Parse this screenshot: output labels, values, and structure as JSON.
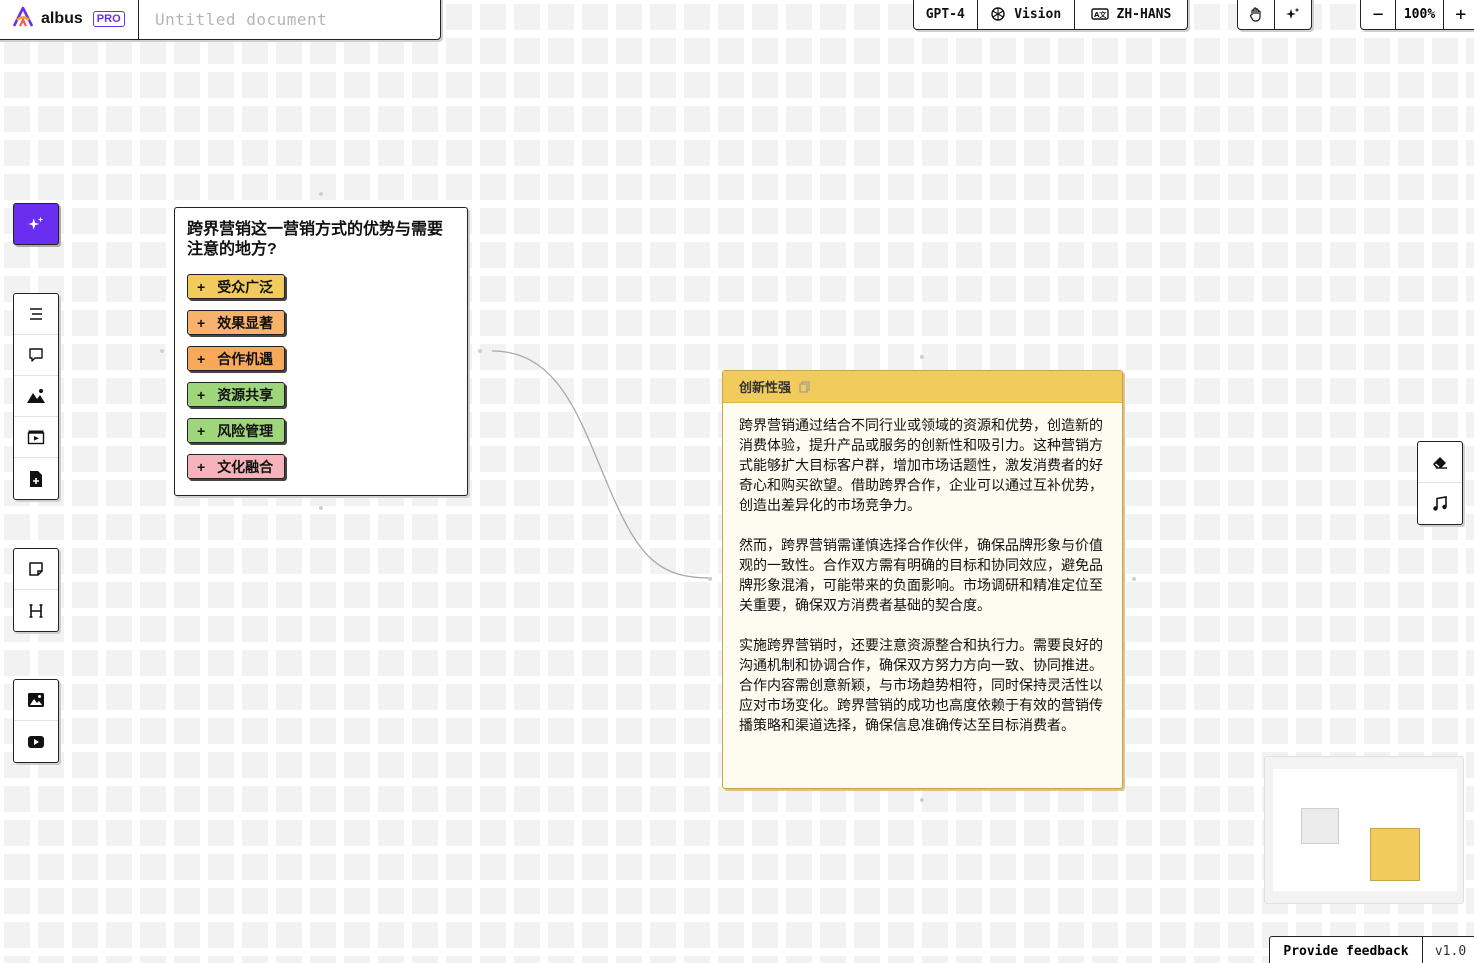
{
  "app": {
    "name": "albus",
    "badge": "PRO",
    "document_title_placeholder": "Untitled document"
  },
  "header": {
    "model": "GPT-4",
    "vision": "Vision",
    "language": "ZH-HANS",
    "zoom_level": "100%",
    "zoom_out": "−",
    "zoom_in": "+"
  },
  "question_card": {
    "question": "跨界营销这一营销方式的优势与需要注意的地方?",
    "chips": [
      {
        "label": "受众广泛",
        "color": "#f1cc5c"
      },
      {
        "label": "效果显著",
        "color": "#f8b26c"
      },
      {
        "label": "合作机遇",
        "color": "#f8a85a"
      },
      {
        "label": "资源共享",
        "color": "#9fd67c"
      },
      {
        "label": "风险管理",
        "color": "#9fd67c"
      },
      {
        "label": "文化融合",
        "color": "#f7b3bb"
      }
    ],
    "plus": "+"
  },
  "note_card": {
    "title": "创新性强",
    "paragraphs": [
      "跨界营销通过结合不同行业或领域的资源和优势，创造新的消费体验，提升产品或服务的创新性和吸引力。这种营销方式能够扩大目标客户群，增加市场话题性，激发消费者的好奇心和购买欲望。借助跨界合作，企业可以通过互补优势，创造出差异化的市场竞争力。",
      "然而，跨界营销需谨慎选择合作伙伴，确保品牌形象与价值观的一致性。合作双方需有明确的目标和协同效应，避免品牌形象混淆，可能带来的负面影响。市场调研和精准定位至关重要，确保双方消费者基础的契合度。",
      "实施跨界营销时，还要注意资源整合和执行力。需要良好的沟通机制和协调合作，确保双方努力方向一致、协同推进。合作内容需创意新颖，与市场趋势相符，同时保持灵活性以应对市场变化。跨界营销的成功也高度依赖于有效的营销传播策略和渠道选择，确保信息准确传达至目标消费者。"
    ]
  },
  "footer": {
    "feedback": "Provide feedback",
    "version": "v1.0"
  },
  "colors": {
    "accent": "#6a2ef0",
    "note_header": "#f1cc5c"
  }
}
